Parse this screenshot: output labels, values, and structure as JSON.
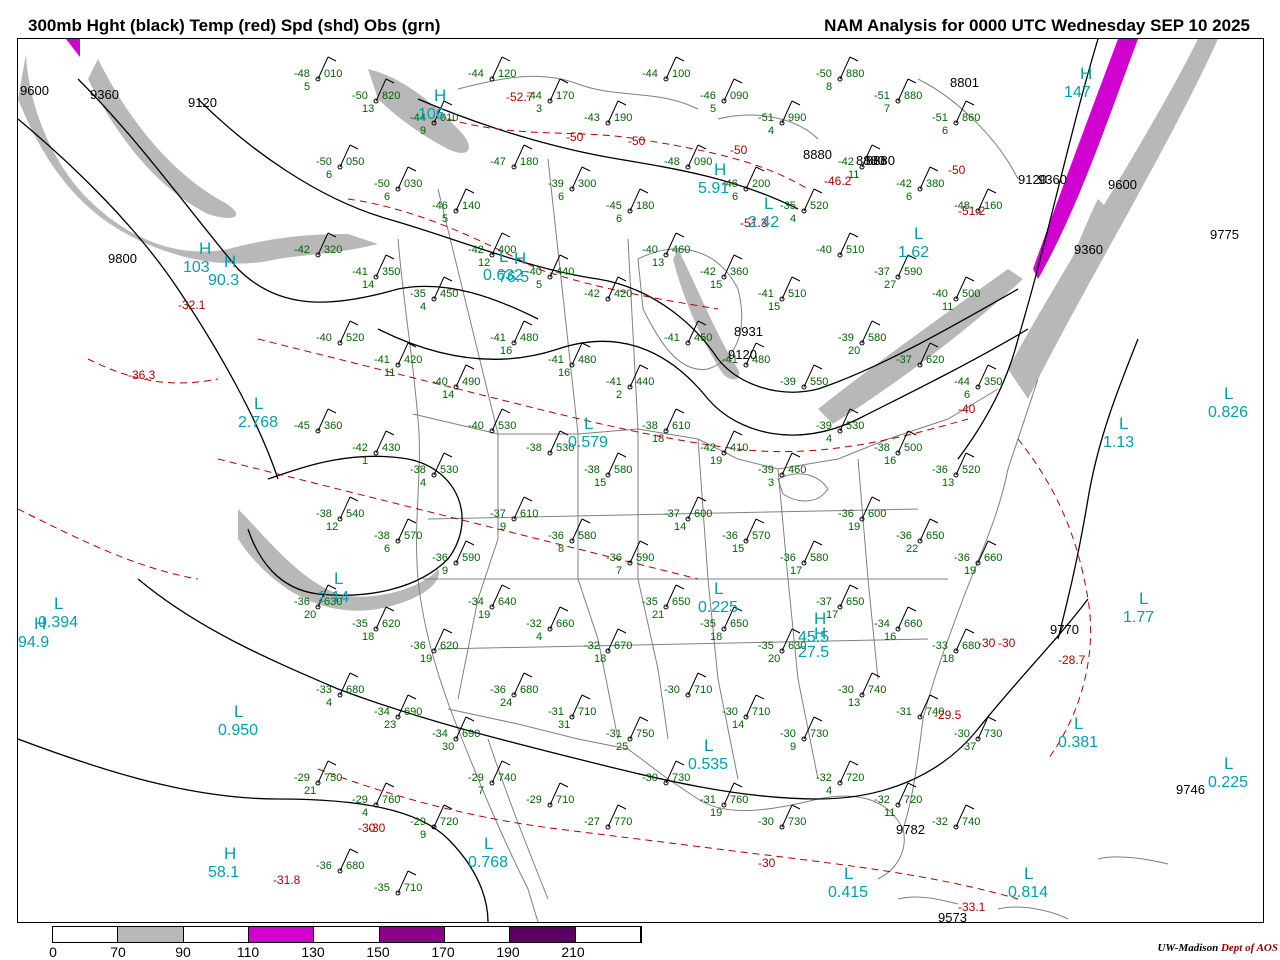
{
  "header": {
    "left_title": "300mb Hght (black) Temp (red) Spd (shd) Obs (grn)",
    "right_title": "NAM Analysis for 0000 UTC Wednesday  SEP 10 2025"
  },
  "colors": {
    "height": "#000000",
    "temp": "#b00000",
    "obs": "#006400",
    "speed_label": "#00a0b0",
    "map": "#808080",
    "shade_70_90": "#b8b8b8",
    "shade_110_130": "#d000d0",
    "shade_150_170": "#8c008c",
    "shade_190_210": "#5a0060"
  },
  "colorbar": {
    "segments": [
      {
        "fill": "#ffffff"
      },
      {
        "fill": "#b8b8b8"
      },
      {
        "fill": "#ffffff"
      },
      {
        "fill": "#d000d0"
      },
      {
        "fill": "#ffffff"
      },
      {
        "fill": "#8c008c"
      },
      {
        "fill": "#ffffff"
      },
      {
        "fill": "#5a0060"
      },
      {
        "fill": "#ffffff"
      }
    ],
    "labels": [
      "0",
      "70",
      "90",
      "110",
      "130",
      "150",
      "170",
      "190",
      "210"
    ]
  },
  "credit": {
    "org": "UW-Madison",
    "dept": "Dept of AOS"
  },
  "height_labels": [
    "9600",
    "9360",
    "9120",
    "9800",
    "8880",
    "8801",
    "8880",
    "8880",
    "9120",
    "9360",
    "9600",
    "9775",
    "8931",
    "9120",
    "9360",
    "9770",
    "9746",
    "9782",
    "9573"
  ],
  "temp_labels": [
    "-52.7",
    "-50",
    "-50",
    "-50",
    "-46.2",
    "-51.3",
    "-51.2",
    "-50",
    "-32.1",
    "-36.3",
    "-40",
    "-30",
    "-30",
    "-28.7",
    "-29.5",
    "-30",
    "-31.8",
    "-33.1",
    "-30",
    "-30"
  ],
  "speed_centers": [
    {
      "letter": "H",
      "value": "106"
    },
    {
      "letter": "H",
      "value": "147"
    },
    {
      "letter": "H",
      "value": "103"
    },
    {
      "letter": "H",
      "value": "76.5"
    },
    {
      "letter": "H",
      "value": "5.91"
    },
    {
      "letter": "H",
      "value": "90.3"
    },
    {
      "letter": "L",
      "value": "0.394"
    },
    {
      "letter": "L",
      "value": "2.768"
    },
    {
      "letter": "L",
      "value": "0.579"
    },
    {
      "letter": "L",
      "value": "1.62"
    },
    {
      "letter": "L",
      "value": "2.42"
    },
    {
      "letter": "L",
      "value": "0.826"
    },
    {
      "letter": "L",
      "value": "1.13"
    },
    {
      "letter": "H",
      "value": "94.9"
    },
    {
      "letter": "L",
      "value": "0.950"
    },
    {
      "letter": "H",
      "value": "45.5"
    },
    {
      "letter": "L",
      "value": "1.77"
    },
    {
      "letter": "L",
      "value": "0.381"
    },
    {
      "letter": "L",
      "value": "0.535"
    },
    {
      "letter": "L",
      "value": "0.768"
    },
    {
      "letter": "H",
      "value": "58.1"
    },
    {
      "letter": "L",
      "value": "0.415"
    },
    {
      "letter": "L",
      "value": "0.814"
    },
    {
      "letter": "L",
      "value": "0.632"
    },
    {
      "letter": "L",
      "value": "0.225"
    },
    {
      "letter": "L",
      "value": "0.225"
    },
    {
      "letter": "H",
      "value": "27.5"
    },
    {
      "letter": "L",
      "value": "2.14"
    }
  ],
  "stations": [
    {
      "temp": "-48",
      "hght": "010",
      "dew": "5"
    },
    {
      "temp": "-50",
      "hght": "820",
      "dew": "13"
    },
    {
      "temp": "-44",
      "hght": "010",
      "dew": "9"
    },
    {
      "temp": "-44",
      "hght": "120",
      "dew": ""
    },
    {
      "temp": "-44",
      "hght": "170",
      "dew": "3"
    },
    {
      "temp": "-43",
      "hght": "190",
      "dew": ""
    },
    {
      "temp": "-44",
      "hght": "100",
      "dew": ""
    },
    {
      "temp": "-46",
      "hght": "090",
      "dew": "5"
    },
    {
      "temp": "-51",
      "hght": "990",
      "dew": "4"
    },
    {
      "temp": "-50",
      "hght": "880",
      "dew": "8"
    },
    {
      "temp": "-51",
      "hght": "880",
      "dew": "7"
    },
    {
      "temp": "-51",
      "hght": "860",
      "dew": "6"
    },
    {
      "temp": "-50",
      "hght": "050",
      "dew": "6"
    },
    {
      "temp": "-50",
      "hght": "030",
      "dew": "6"
    },
    {
      "temp": "-46",
      "hght": "140",
      "dew": "5"
    },
    {
      "temp": "-47",
      "hght": "180",
      "dew": ""
    },
    {
      "temp": "-39",
      "hght": "300",
      "dew": "6"
    },
    {
      "temp": "-45",
      "hght": "180",
      "dew": "6"
    },
    {
      "temp": "-48",
      "hght": "090",
      "dew": ""
    },
    {
      "temp": "-46",
      "hght": "200",
      "dew": "6"
    },
    {
      "temp": "-35",
      "hght": "520",
      "dew": "4"
    },
    {
      "temp": "-42",
      "hght": "430",
      "dew": "11"
    },
    {
      "temp": "-42",
      "hght": "380",
      "dew": "6"
    },
    {
      "temp": "-48",
      "hght": "160",
      "dew": ""
    },
    {
      "temp": "-42",
      "hght": "320",
      "dew": ""
    },
    {
      "temp": "-41",
      "hght": "350",
      "dew": "14"
    },
    {
      "temp": "-35",
      "hght": "450",
      "dew": "4"
    },
    {
      "temp": "-42",
      "hght": "400",
      "dew": "12"
    },
    {
      "temp": "-40",
      "hght": "440",
      "dew": "5"
    },
    {
      "temp": "-42",
      "hght": "420",
      "dew": ""
    },
    {
      "temp": "-40",
      "hght": "460",
      "dew": "13"
    },
    {
      "temp": "-42",
      "hght": "360",
      "dew": "15"
    },
    {
      "temp": "-41",
      "hght": "510",
      "dew": "15"
    },
    {
      "temp": "-40",
      "hght": "510",
      "dew": ""
    },
    {
      "temp": "-37",
      "hght": "590",
      "dew": "27"
    },
    {
      "temp": "-40",
      "hght": "500",
      "dew": "11"
    },
    {
      "temp": "-40",
      "hght": "520",
      "dew": ""
    },
    {
      "temp": "-41",
      "hght": "420",
      "dew": "11"
    },
    {
      "temp": "-40",
      "hght": "490",
      "dew": "14"
    },
    {
      "temp": "-41",
      "hght": "480",
      "dew": "16"
    },
    {
      "temp": "-41",
      "hght": "480",
      "dew": "16"
    },
    {
      "temp": "-41",
      "hght": "440",
      "dew": "2"
    },
    {
      "temp": "-41",
      "hght": "450",
      "dew": ""
    },
    {
      "temp": "-41",
      "hght": "480",
      "dew": ""
    },
    {
      "temp": "-39",
      "hght": "550",
      "dew": ""
    },
    {
      "temp": "-39",
      "hght": "580",
      "dew": "20"
    },
    {
      "temp": "-37",
      "hght": "620",
      "dew": ""
    },
    {
      "temp": "-44",
      "hght": "350",
      "dew": "6"
    },
    {
      "temp": "-45",
      "hght": "360",
      "dew": ""
    },
    {
      "temp": "-42",
      "hght": "430",
      "dew": "1"
    },
    {
      "temp": "-38",
      "hght": "530",
      "dew": "4"
    },
    {
      "temp": "-40",
      "hght": "530",
      "dew": ""
    },
    {
      "temp": "-38",
      "hght": "530",
      "dew": ""
    },
    {
      "temp": "-38",
      "hght": "580",
      "dew": "15"
    },
    {
      "temp": "-38",
      "hght": "610",
      "dew": "18"
    },
    {
      "temp": "-42",
      "hght": "410",
      "dew": "19"
    },
    {
      "temp": "-39",
      "hght": "460",
      "dew": "3"
    },
    {
      "temp": "-39",
      "hght": "530",
      "dew": "4"
    },
    {
      "temp": "-38",
      "hght": "500",
      "dew": "16"
    },
    {
      "temp": "-36",
      "hght": "520",
      "dew": "13"
    },
    {
      "temp": "-38",
      "hght": "540",
      "dew": "12"
    },
    {
      "temp": "-38",
      "hght": "570",
      "dew": "6"
    },
    {
      "temp": "-36",
      "hght": "590",
      "dew": "9"
    },
    {
      "temp": "-37",
      "hght": "610",
      "dew": "9"
    },
    {
      "temp": "-36",
      "hght": "580",
      "dew": "8"
    },
    {
      "temp": "-36",
      "hght": "590",
      "dew": "7"
    },
    {
      "temp": "-37",
      "hght": "600",
      "dew": "14"
    },
    {
      "temp": "-36",
      "hght": "570",
      "dew": "15"
    },
    {
      "temp": "-36",
      "hght": "580",
      "dew": "17"
    },
    {
      "temp": "-36",
      "hght": "600",
      "dew": "19"
    },
    {
      "temp": "-36",
      "hght": "650",
      "dew": "22"
    },
    {
      "temp": "-36",
      "hght": "660",
      "dew": "19"
    },
    {
      "temp": "-36",
      "hght": "630",
      "dew": "20"
    },
    {
      "temp": "-35",
      "hght": "620",
      "dew": "18"
    },
    {
      "temp": "-36",
      "hght": "620",
      "dew": "19"
    },
    {
      "temp": "-34",
      "hght": "640",
      "dew": "19"
    },
    {
      "temp": "-32",
      "hght": "660",
      "dew": "4"
    },
    {
      "temp": "-32",
      "hght": "670",
      "dew": "18"
    },
    {
      "temp": "-35",
      "hght": "650",
      "dew": "21"
    },
    {
      "temp": "-35",
      "hght": "650",
      "dew": "18"
    },
    {
      "temp": "-35",
      "hght": "630",
      "dew": "20"
    },
    {
      "temp": "-37",
      "hght": "650",
      "dew": "17"
    },
    {
      "temp": "-34",
      "hght": "660",
      "dew": "16"
    },
    {
      "temp": "-33",
      "hght": "680",
      "dew": "18"
    },
    {
      "temp": "-33",
      "hght": "680",
      "dew": "4"
    },
    {
      "temp": "-34",
      "hght": "690",
      "dew": "23"
    },
    {
      "temp": "-34",
      "hght": "690",
      "dew": "30"
    },
    {
      "temp": "-36",
      "hght": "680",
      "dew": "24"
    },
    {
      "temp": "-31",
      "hght": "710",
      "dew": "31"
    },
    {
      "temp": "-31",
      "hght": "750",
      "dew": "25"
    },
    {
      "temp": "-30",
      "hght": "710",
      "dew": ""
    },
    {
      "temp": "-30",
      "hght": "710",
      "dew": "14"
    },
    {
      "temp": "-30",
      "hght": "730",
      "dew": "9"
    },
    {
      "temp": "-30",
      "hght": "740",
      "dew": "13"
    },
    {
      "temp": "-31",
      "hght": "740",
      "dew": ""
    },
    {
      "temp": "-30",
      "hght": "730",
      "dew": "37"
    },
    {
      "temp": "-29",
      "hght": "750",
      "dew": "21"
    },
    {
      "temp": "-29",
      "hght": "760",
      "dew": "4"
    },
    {
      "temp": "-29",
      "hght": "720",
      "dew": "9"
    },
    {
      "temp": "-29",
      "hght": "740",
      "dew": "7"
    },
    {
      "temp": "-29",
      "hght": "710",
      "dew": ""
    },
    {
      "temp": "-27",
      "hght": "770",
      "dew": ""
    },
    {
      "temp": "-30",
      "hght": "730",
      "dew": ""
    },
    {
      "temp": "-31",
      "hght": "760",
      "dew": "19"
    },
    {
      "temp": "-30",
      "hght": "730",
      "dew": ""
    },
    {
      "temp": "-32",
      "hght": "720",
      "dew": "4"
    },
    {
      "temp": "-32",
      "hght": "720",
      "dew": "11"
    },
    {
      "temp": "-32",
      "hght": "740",
      "dew": ""
    },
    {
      "temp": "-36",
      "hght": "680",
      "dew": ""
    },
    {
      "temp": "-35",
      "hght": "710",
      "dew": ""
    },
    {
      "temp": "-30",
      "hght": "30",
      "dew": ""
    }
  ]
}
